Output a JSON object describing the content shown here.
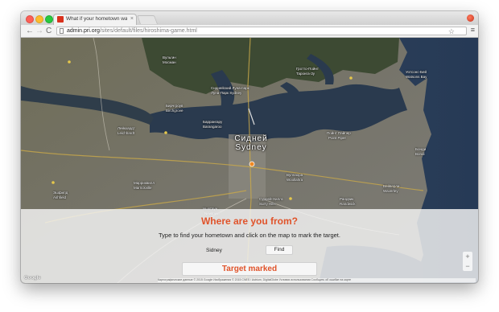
{
  "browser": {
    "tab_title": "What if your hometown wa",
    "tab_close": "×",
    "url_host": "admin.pri.org",
    "url_path": "/sites/default/files/hiroshima-game.html"
  },
  "toolbar_icons": {
    "back": "←",
    "forward": "→",
    "reload": "C",
    "star": "☆",
    "menu": "≡"
  },
  "map": {
    "city_label_local": "Сидней",
    "city_label": "Sydney",
    "labels": [
      "Вульгин",
      "Мосман",
      "Гротто-Пойнт",
      "Таронга-Зу",
      "Сиднейский Луна-парк",
      "Луна-Парк Sydney",
      "Пойнт Пайпер",
      "Point Piper",
      "Суррей-Хиллс",
      "Surry Hills",
      "Марриквилл",
      "Marrickville",
      "Вейверли",
      "Waverley",
      "Вуллахра",
      "Woollahra",
      "Уотсонс-Бей",
      "Watsons Bay",
      "Рандвик",
      "Randwick",
      "Ньютаун",
      "Newtown",
      "Лейкхардт",
      "Leichhardt",
      "Баррангару",
      "Barangaroo",
      "Бонди",
      "Bondi",
      "Эшфилд",
      "Ashfield",
      "Бирчгроув",
      "Birchgrove"
    ]
  },
  "game": {
    "heading": "Where are you from?",
    "instructions": "Type to find your hometown and click on the map to mark the target.",
    "search_value": "Sidney",
    "find_label": "Find",
    "target_label": "Target marked"
  },
  "map_controls": {
    "zoom_in": "+",
    "zoom_out": "−",
    "logo": "Google",
    "attribution": "Картографические данные © 2015 Google Изображения © 2015 CNES / Astrium, DigitalGlobe Условия использования Сообщить об ошибке на карте"
  },
  "colors": {
    "accent": "#e0532a",
    "water": "#1f2c3e",
    "land": "#6b6a5c"
  }
}
